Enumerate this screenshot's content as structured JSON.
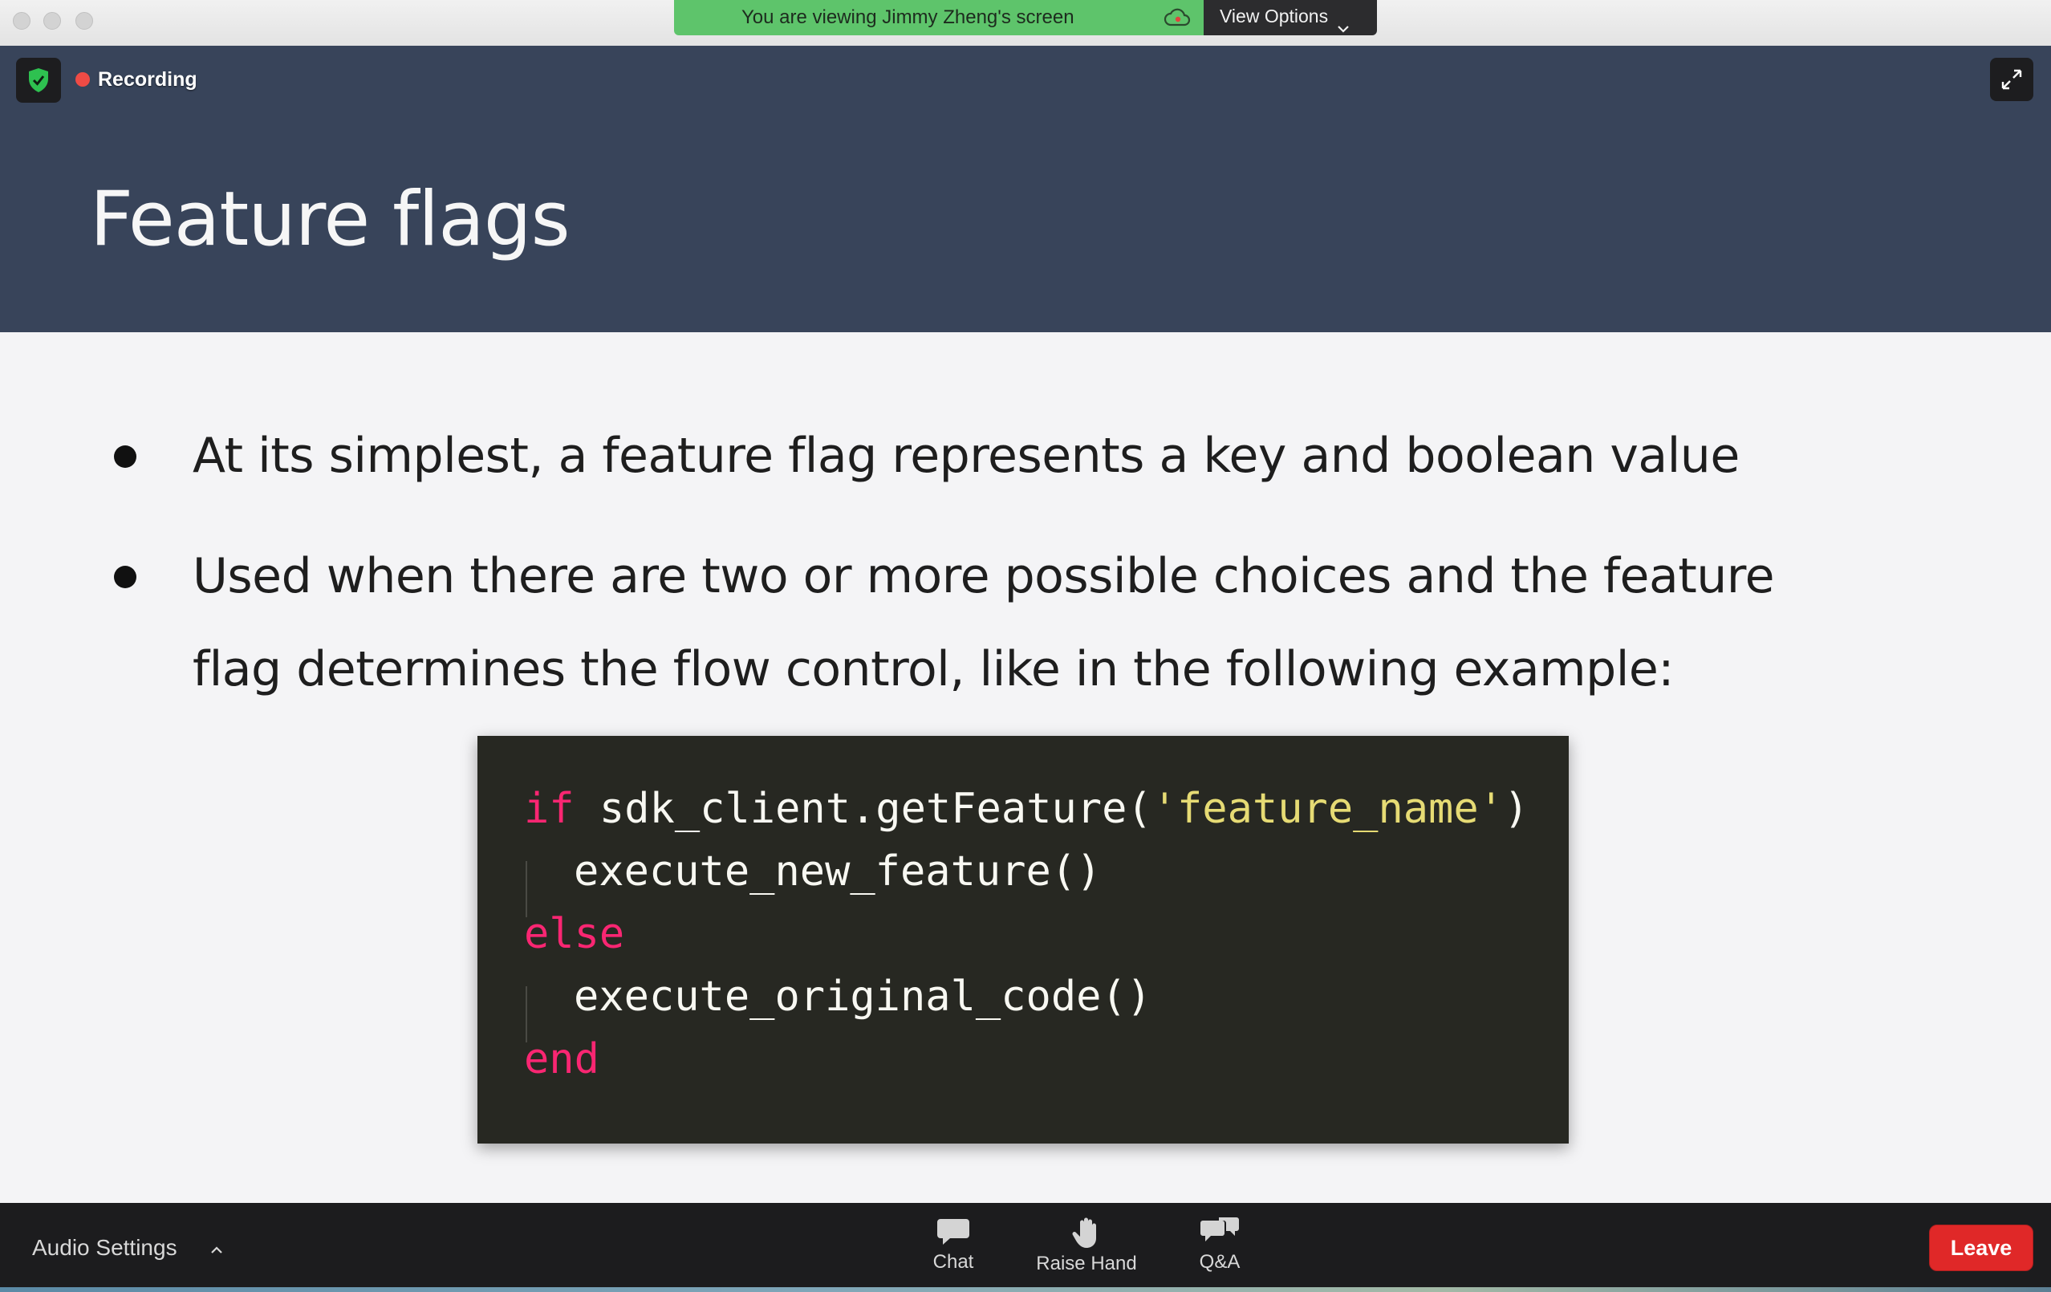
{
  "window": {
    "share_banner_text": "You are viewing Jimmy Zheng's screen",
    "view_options_label": "View Options"
  },
  "meeting": {
    "recording_label": "Recording"
  },
  "slide": {
    "title": "Feature flags",
    "bullets": [
      {
        "lines": [
          "At its simplest, a feature flag represents a key and boolean value"
        ]
      },
      {
        "lines": [
          "Used when there are two or more possible choices and the feature",
          "flag determines the flow control, like in the following example:"
        ]
      }
    ],
    "code": {
      "line1_keyword": "if",
      "line1_call": " sdk_client.getFeature(",
      "line1_string": "'feature_name'",
      "line1_close": ")",
      "line2": "execute_new_feature()",
      "line3_keyword": "else",
      "line4": "execute_original_code()",
      "line5_keyword": "end"
    }
  },
  "controls": {
    "audio_settings_label": "Audio Settings",
    "chat_label": "Chat",
    "raise_hand_label": "Raise Hand",
    "qa_label": "Q&A",
    "leave_label": "Leave"
  },
  "colors": {
    "share_banner": "#5ec46b",
    "slide_header": "#38445a",
    "code_background": "#272822",
    "code_keyword": "#f92672",
    "code_string": "#e6db74",
    "leave_button": "#e02828",
    "recording_dot": "#ef4b45"
  },
  "icons": {
    "security": "shield-check-icon",
    "fullscreen": "expand-arrows-icon",
    "chat": "chat-bubble-icon",
    "raise_hand": "hand-icon",
    "qa": "qa-bubbles-icon",
    "cloud": "cloud-recording-icon",
    "view_options_caret": "chevron-down-icon",
    "audio_caret": "chevron-up-icon"
  }
}
